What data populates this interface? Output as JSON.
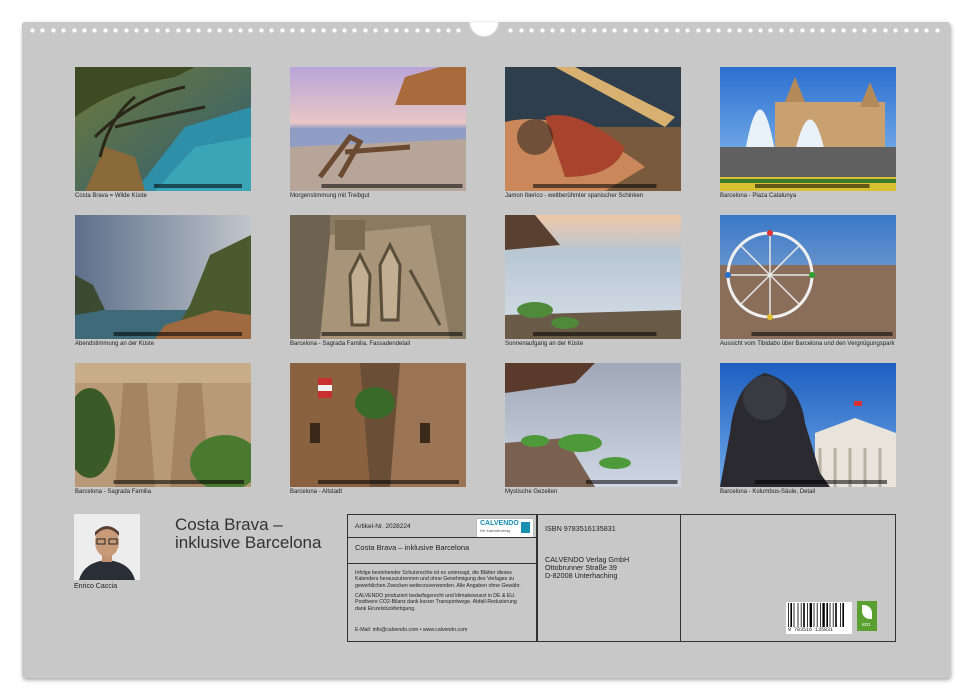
{
  "photos": [
    {
      "caption": "Costa Brava = Wilde Küste"
    },
    {
      "caption": "Morgenstimmung mit Treibgut"
    },
    {
      "caption": "Jamon Iberico - weltberühmter spanischer Schinken"
    },
    {
      "caption": "Barcelona - Plaza Catalunya"
    },
    {
      "caption": "Abendstimmung an der Küste"
    },
    {
      "caption": "Barcelona - Sagrada Familia, Fassadendetail"
    },
    {
      "caption": "Sonnenaufgang an der Küste"
    },
    {
      "caption": "Aussicht vom Tibidabo über Barcelona und den Vergnügungspark"
    },
    {
      "caption": "Barcelona - Sagrada Familia"
    },
    {
      "caption": "Barcelona - Altstadt"
    },
    {
      "caption": "Mystische Gezeiten"
    },
    {
      "caption": "Barcelona - Kolumbus-Säule, Detail"
    }
  ],
  "author": {
    "name": "Enrico Caccia"
  },
  "title": "Costa Brava – inklusive Barcelona",
  "info": {
    "article_label": "Artikel-Nr. 2028224",
    "brand": "CALVENDO",
    "brand_sub": "Der Kalenderverlag",
    "subtitle": "Costa Brava – inklusive Barcelona",
    "copyright": "Infolge bestehender Schutzrechte ist es untersagt, die Blätter dieses Kalenders herauszutrennen und ohne Genehmigung des Verlages zu gewerblichen Zwecken weiterzuverwenden. Alle Angaben ohne Gewähr.",
    "climate": "CALVENDO produziert bedarfsgerecht und klimabewusst in DE & EU. Positivere CO2-Bilanz dank kurzer Transportwege. Abfall-Reduzierung dank Einzelstückfertigung.",
    "contact": "E-Mail: info@calvendo.com • www.calvendo.com",
    "isbn": "ISBN 9783516135831",
    "publisher_name": "CALVENDO Verlag GmbH",
    "publisher_street": "Ottobrunner Straße 39",
    "publisher_city": "D-82008 Unterhaching",
    "barcode_number": "9 783516 135831",
    "eco_label": "eco"
  }
}
